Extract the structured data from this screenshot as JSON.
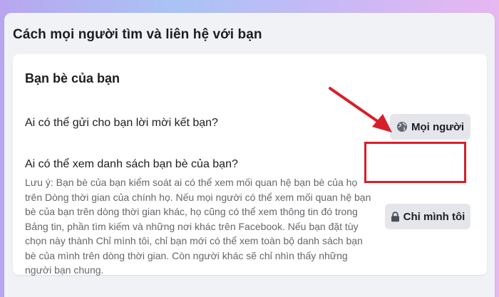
{
  "section": {
    "title": "Cách mọi người tìm và liên hệ với bạn"
  },
  "card": {
    "title": "Bạn bè của bạn",
    "friend_request": {
      "question": "Ai có thể gửi cho bạn lời mời kết bạn?",
      "button_label": "Mọi người",
      "button_icon": "globe-icon"
    },
    "friends_list": {
      "question": "Ai có thể xem danh sách bạn bè của bạn?",
      "note": "Lưu ý: Bạn bè của bạn kiểm soát ai có thể xem mối quan hệ bạn bè của họ trên Dòng thời gian của chính họ. Nếu mọi người có thể xem mối quan hệ bạn bè của bạn trên dòng thời gian khác, họ cũng có thể xem thông tin đó trong Bảng tin, phần tìm kiếm và những nơi khác trên Facebook. Nếu bạn đặt tùy chọn này thành Chỉ mình tôi, chỉ bạn mới có thể xem toàn bộ danh sách bạn bè của mình trên dòng thời gian. Còn người khác sẽ chỉ nhìn thấy những người bạn chung.",
      "button_label": "Chỉ mình tôi",
      "button_icon": "lock-icon"
    }
  },
  "annotation": {
    "color": "#d81e2a"
  }
}
